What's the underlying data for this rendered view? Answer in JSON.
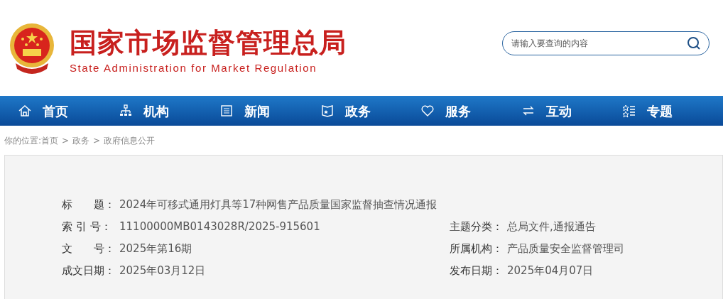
{
  "header": {
    "title": "国家市场监督管理总局",
    "subtitle": "State Administration for Market Regulation"
  },
  "search": {
    "placeholder": "请输入要查询的内容"
  },
  "nav": [
    {
      "label": "首页",
      "kind": "home"
    },
    {
      "label": "机构",
      "kind": "org"
    },
    {
      "label": "新闻",
      "kind": "news"
    },
    {
      "label": "政务",
      "kind": "gov"
    },
    {
      "label": "服务",
      "kind": "service"
    },
    {
      "label": "互动",
      "kind": "interact"
    },
    {
      "label": "专题",
      "kind": "topic"
    }
  ],
  "breadcrumb": {
    "prefix": "你的位置:",
    "items": [
      "首页",
      "政务",
      "政府信息公开"
    ],
    "separator": ">"
  },
  "info": {
    "rows": [
      [
        {
          "label": "标　　题：",
          "value": "2024年可移式通用灯具等17种网售产品质量国家监督抽查情况通报"
        }
      ],
      [
        {
          "label": "索 引 号：",
          "value": "11100000MB0143028R/2025-915601"
        },
        {
          "label": "主题分类：",
          "value": "总局文件,通报通告"
        }
      ],
      [
        {
          "label": "文　　号：",
          "value": "2025年第16期"
        },
        {
          "label": "所属机构：",
          "value": "产品质量安全监督管理司"
        }
      ],
      [
        {
          "label": "成文日期：",
          "value": "2025年03月12日"
        },
        {
          "label": "发布日期：",
          "value": "2025年04月07日"
        }
      ]
    ]
  }
}
